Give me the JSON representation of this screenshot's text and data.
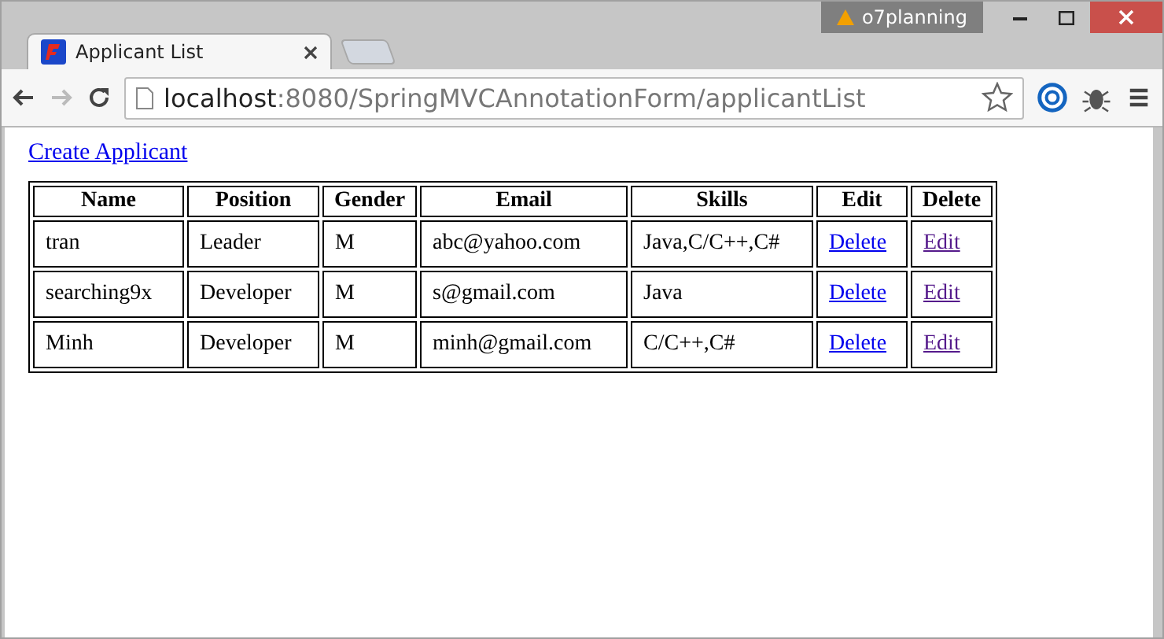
{
  "window": {
    "user_badge": "o7planning"
  },
  "tabs": [
    {
      "title": "Applicant List",
      "selected": true
    }
  ],
  "address_bar": {
    "host": "localhost",
    "rest": ":8080/SpringMVCAnnotationForm/applicantList"
  },
  "page": {
    "create_link": "Create Applicant",
    "table": {
      "columns": [
        "Name",
        "Position",
        "Gender",
        "Email",
        "Skills",
        "Edit",
        "Delete"
      ],
      "rows": [
        {
          "cells": [
            "tran",
            "Leader",
            "M",
            "abc@yahoo.com",
            "Java,C/C++,C#"
          ],
          "links": [
            {
              "label": "Delete",
              "visited": false
            },
            {
              "label": "Edit",
              "visited": true
            }
          ]
        },
        {
          "cells": [
            "searching9x",
            "Developer",
            "M",
            "s@gmail.com",
            "Java"
          ],
          "links": [
            {
              "label": "Delete",
              "visited": false
            },
            {
              "label": "Edit",
              "visited": true
            }
          ]
        },
        {
          "cells": [
            "Minh",
            "Developer",
            "M",
            "minh@gmail.com",
            "C/C++,C#"
          ],
          "links": [
            {
              "label": "Delete",
              "visited": false
            },
            {
              "label": "Edit",
              "visited": true
            }
          ]
        }
      ]
    }
  }
}
